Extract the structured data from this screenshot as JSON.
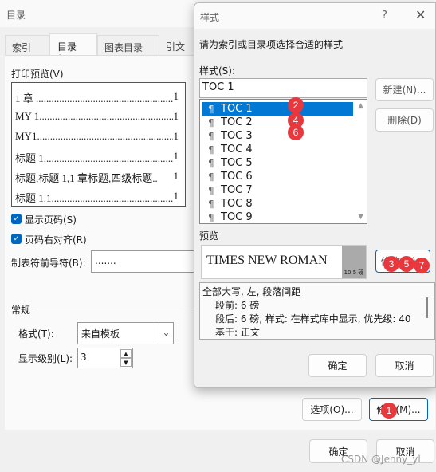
{
  "back_dialog": {
    "title": "目录",
    "tabs": [
      {
        "label": "索引(X)"
      },
      {
        "label": "目录(C)"
      },
      {
        "label": "图表目录(F)"
      },
      {
        "label": "引文目"
      }
    ],
    "print_preview_label": "打印预览(V)",
    "preview_entries": [
      {
        "text": "1 章 ........................................................",
        "page": "1"
      },
      {
        "text": "MY 1........................................................",
        "page": "1"
      },
      {
        "text": "MY1.........................................................",
        "page": "1"
      },
      {
        "text": "标题 1.....................................................",
        "page": "1"
      },
      {
        "text": "标题,标题 1,1 章标题,四级标题..",
        "page": "1"
      },
      {
        "text": "标题 1.1...................................................",
        "page": "1"
      }
    ],
    "show_page_numbers": {
      "label": "显示页码(S)",
      "checked": true
    },
    "right_align": {
      "label": "页码右对齐(R)",
      "checked": true
    },
    "tab_leader": {
      "label": "制表符前导符(B):",
      "value": "......."
    },
    "general_label": "常规",
    "format": {
      "label": "格式(T):",
      "value": "来自模板"
    },
    "show_levels": {
      "label": "显示级别(L):",
      "value": "3"
    },
    "options_button": "选项(O)...",
    "modify_button": "修改(M)...",
    "ok_button": "确定",
    "cancel_button": "取消"
  },
  "style_dialog": {
    "title": "样式",
    "help": "?",
    "instruction": "请为索引或目录项选择合适的样式",
    "styles_label": "样式(S):",
    "style_input": "TOC 1",
    "styles": [
      "TOC 1",
      "TOC 2",
      "TOC 3",
      "TOC 4",
      "TOC 5",
      "TOC 6",
      "TOC 7",
      "TOC 8",
      "TOC 9"
    ],
    "selected_index": 0,
    "new_button": "新建(N)...",
    "delete_button": "删除(D)",
    "preview_label": "预览",
    "preview_text": "TIMES NEW ROMAN",
    "preview_size": "10.5 磅",
    "modify_button": "修改(M)...",
    "description": [
      "全部大写, 左, 段落间距",
      "段前: 6 磅",
      "段后: 6 磅, 样式: 在样式库中显示, 优先级: 40",
      "基于: 正文"
    ],
    "ok_button": "确定",
    "cancel_button": "取消"
  },
  "badges": [
    "1",
    "2",
    "3",
    "4",
    "5",
    "6",
    "7"
  ],
  "watermark": "CSDN @Jenny_yl",
  "colors": {
    "accent": "#0078d4",
    "badge": "#e8383d"
  }
}
